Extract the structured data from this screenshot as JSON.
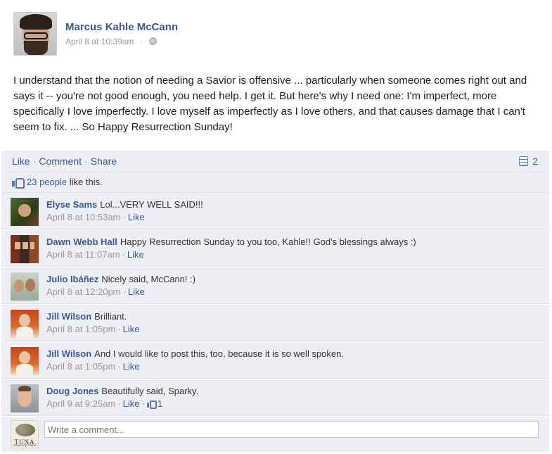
{
  "post": {
    "author": "Marcus Kahle McCann",
    "timestamp": "April 8 at 10:39am",
    "separator": "·",
    "privacy_icon": "globe-icon",
    "body": "I understand that the notion of needing a Savior is offensive ... particularly when someone comes right out and says it -- you're not good enough, you need help. I get it. But here's why I need one: I'm imperfect, more specifically I love imperfectly. I love myself as imperfectly as I love others, and that causes damage that I can't seem to fix. ... So Happy Resurrection Sunday!"
  },
  "actions": {
    "like": "Like",
    "comment": "Comment",
    "share": "Share",
    "dot": "·",
    "share_count": "2",
    "share_icon": "shares-icon"
  },
  "likes": {
    "icon": "thumbs-up-icon",
    "count_text": "23 people",
    "suffix": " like this."
  },
  "comments": [
    {
      "name": "Elyse Sams",
      "text": "Lol...VERY WELL SAID!!!",
      "time": "April 8 at 10:53am",
      "like": "Like"
    },
    {
      "name": "Dawn Webb Hall",
      "text": "Happy Resurrection Sunday to you too, Kahle!! God's blessings always :)",
      "time": "April 8 at 11:07am",
      "like": "Like"
    },
    {
      "name": "Julio Ibáñez",
      "text": "Nicely said, McCann! :)",
      "time": "April 8 at 12:20pm",
      "like": "Like"
    },
    {
      "name": "Jill Wilson",
      "text": "Brilliant.",
      "time": "April 8 at 1:05pm",
      "like": "Like"
    },
    {
      "name": "Jill Wilson",
      "text": "And I would like to post this, too, because it is so well spoken.",
      "time": "April 8 at 1:05pm",
      "like": "Like"
    },
    {
      "name": "Doug Jones",
      "text": "Beautifully said, Sparky.",
      "time": "April 9 at 9:25am",
      "like": "Like",
      "like_count": "1"
    }
  ],
  "composer": {
    "placeholder": "Write a comment...",
    "avatar_brand": "TUNA",
    "avatar_sub": "wakening friend"
  },
  "colors": {
    "link": "#3b5998",
    "panel_bg": "#edeff4",
    "meta_gray": "#999999"
  }
}
